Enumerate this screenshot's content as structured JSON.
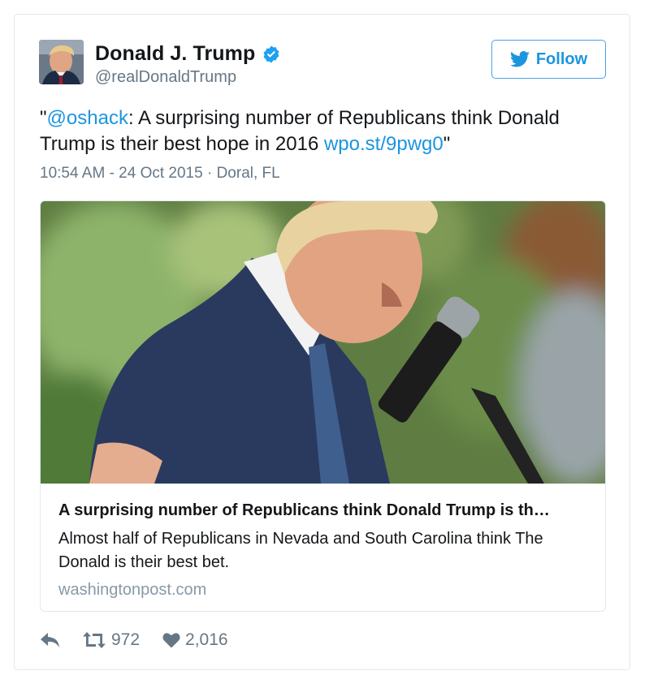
{
  "author": {
    "name": "Donald J. Trump",
    "handle": "@realDonaldTrump",
    "verified_icon": "verified-badge-icon",
    "avatar_icon": "profile-photo"
  },
  "follow_button": {
    "label": "Follow",
    "icon": "twitter-bird-icon"
  },
  "tweet": {
    "open_quote": "\"",
    "mention": "@oshack",
    "text": ": A surprising number of Republicans think Donald Trump is their best hope in 2016 ",
    "link": "wpo.st/9pwg0",
    "close_quote": "\""
  },
  "meta": {
    "timestamp": "10:54 AM - 24 Oct 2015",
    "separator": " · ",
    "location": "Doral, FL"
  },
  "link_card": {
    "image": "speaker-at-microphone-photo",
    "title": "A surprising number of Republicans think Donald Trump is th…",
    "description": "Almost half of Republicans in Nevada and South Carolina think The Donald is their best bet.",
    "domain": "washingtonpost.com"
  },
  "actions": {
    "reply_icon": "reply-icon",
    "retweet_icon": "retweet-icon",
    "retweets": "972",
    "like_icon": "heart-icon",
    "likes": "2,016"
  },
  "colors": {
    "link": "#1b95e0",
    "secondary_text": "#657786",
    "border": "#e1e8ed",
    "verified": "#1da1f2"
  }
}
